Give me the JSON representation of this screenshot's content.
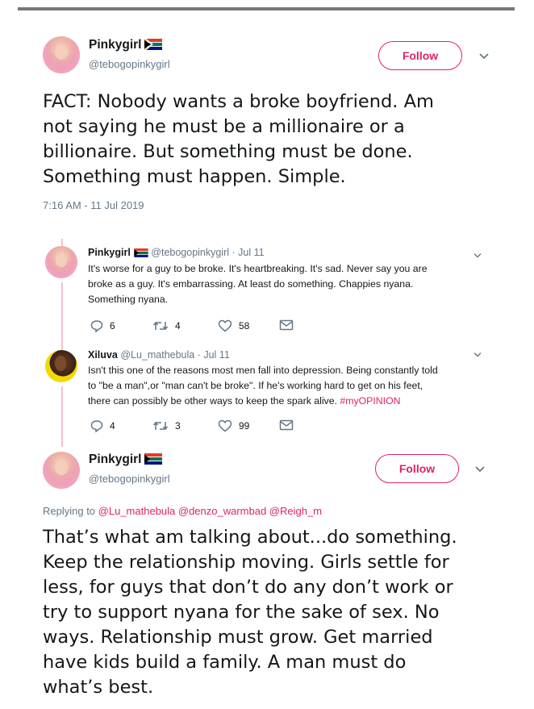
{
  "colors": {
    "accent": "#e0245e",
    "muted": "#657786",
    "text": "#14171a",
    "thread": "#f3c2d2"
  },
  "main_tweet": {
    "name": "Pinkygirl",
    "handle": "@tebogopinkygirl",
    "follow_label": "Follow",
    "text_lines": [
      "FACT: Nobody wants a broke boyfriend. Am",
      "not saying he must be a millionaire or a",
      "billionaire. But something must be done.",
      "Something must happen. Simple."
    ],
    "timestamp": "7:16 AM - 11 Jul 2019",
    "flag_icon": "south-africa-flag-icon"
  },
  "reply1": {
    "name": "Pinkygirl",
    "handle": "@tebogopinkygirl",
    "date": "· Jul 11",
    "text_lines": [
      "It's worse for a guy to be broke. It's heartbreaking. It's sad. Never say you are",
      "broke as a guy. It's embarrassing. At least do something. Chappies nyana.",
      "Something nyana."
    ],
    "replies": "6",
    "retweets": "4",
    "likes": "58"
  },
  "reply2": {
    "name": "Xiluva",
    "handle": "@Lu_mathebula",
    "date": "· Jul 11",
    "text_lines": [
      "Isn't this one of the reasons most men fall into depression. Being constantly told",
      "to \"be a man\",or \"man can't be broke\".  If he's working hard to get on his feet,",
      "there can possibly be other ways to keep the spark alive. "
    ],
    "hashtag": "#myOPINION",
    "replies": "4",
    "retweets": "3",
    "likes": "99"
  },
  "reply3": {
    "name": "Pinkygirl",
    "handle": "@tebogopinkygirl",
    "follow_label": "Follow",
    "replying_prefix": "Replying to",
    "mentions": "@Lu_mathebula @denzo_warmbad @Reigh_m",
    "text_lines": [
      "That’s what am talking about...do something.",
      "Keep the relationship moving. Girls settle for",
      "less, for guys that don’t do any don’t work or",
      "try to support nyana for the sake of sex. No",
      "ways. Relationship must grow. Get married",
      "have kids build a family. A man must do",
      "what’s best."
    ]
  }
}
